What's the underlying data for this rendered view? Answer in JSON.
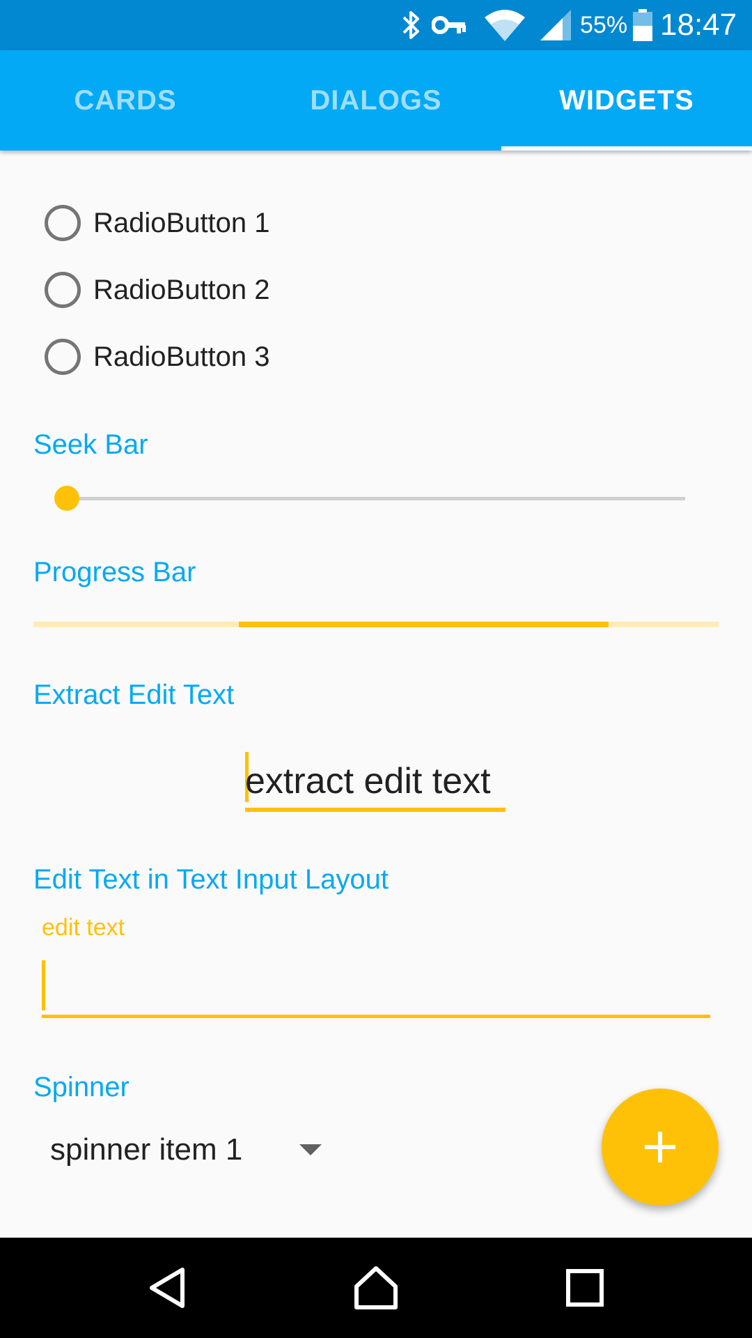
{
  "status_bar": {
    "battery_percent": "55%",
    "time": "18:47",
    "icons": [
      "bluetooth-icon",
      "vpn-key-icon",
      "wifi-icon",
      "cell-signal-icon",
      "battery-icon"
    ]
  },
  "tabs": [
    {
      "label": "CARDS",
      "active": false
    },
    {
      "label": "DIALOGS",
      "active": false
    },
    {
      "label": "WIDGETS",
      "active": true
    }
  ],
  "radio_group": [
    {
      "label": "RadioButton 1",
      "checked": false
    },
    {
      "label": "RadioButton 2",
      "checked": false
    },
    {
      "label": "RadioButton 3",
      "checked": false
    }
  ],
  "seek_bar": {
    "label": "Seek Bar",
    "value_fraction": 0.0
  },
  "progress_bar": {
    "label": "Progress Bar",
    "indeterminate": true,
    "segment_start_fraction": 0.3,
    "segment_end_fraction": 0.84
  },
  "extract_edit_text": {
    "label": "Extract Edit Text",
    "value": "extract edit text"
  },
  "text_input_layout": {
    "label": "Edit Text in Text Input Layout",
    "hint": "edit text",
    "value": ""
  },
  "spinner": {
    "label": "Spinner",
    "selected": "spinner item 1"
  },
  "fab": {
    "icon": "add-icon"
  },
  "nav_bar": {
    "buttons": [
      "back-icon",
      "home-icon",
      "recents-icon"
    ]
  },
  "colors": {
    "primary": "#03A9F4",
    "primary_dark": "#0288D1",
    "accent": "#FFC107",
    "accent_light": "#FFECB3",
    "background": "#FAFAFA"
  }
}
